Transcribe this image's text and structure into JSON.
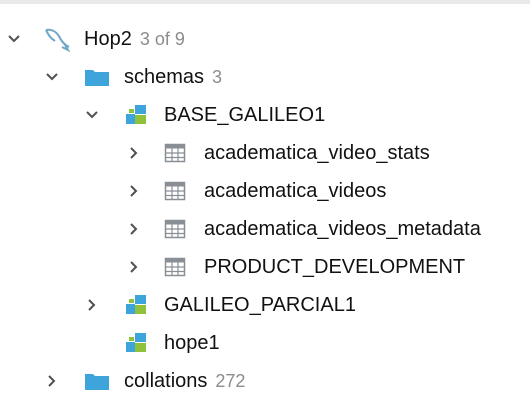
{
  "tree": {
    "connection": {
      "name": "Hop2",
      "count": "3 of 9",
      "icon": "dolphin-icon"
    },
    "schemas_folder": {
      "name": "schemas",
      "count": "3",
      "icon": "folder-icon"
    },
    "schema_base": {
      "name": "BASE_GALILEO1",
      "icon": "database-icon"
    },
    "tables": [
      {
        "name": "academatica_video_stats",
        "icon": "table-icon"
      },
      {
        "name": "academatica_videos",
        "icon": "table-icon"
      },
      {
        "name": "academatica_videos_metadata",
        "icon": "table-icon"
      },
      {
        "name": "PRODUCT_DEVELOPMENT",
        "icon": "table-icon"
      }
    ],
    "schema_parcial": {
      "name": "GALILEO_PARCIAL1",
      "icon": "database-icon"
    },
    "schema_hope": {
      "name": "hope1",
      "icon": "database-icon"
    },
    "collations_folder": {
      "name": "collations",
      "count": "272",
      "icon": "folder-icon"
    }
  },
  "colors": {
    "folder": "#3ea5dc",
    "database": "#3ea5dc",
    "database_accent": "#8fc23a",
    "table_grid": "#8a8f96",
    "count_text": "#8c8c8c",
    "chevron": "#505050"
  }
}
